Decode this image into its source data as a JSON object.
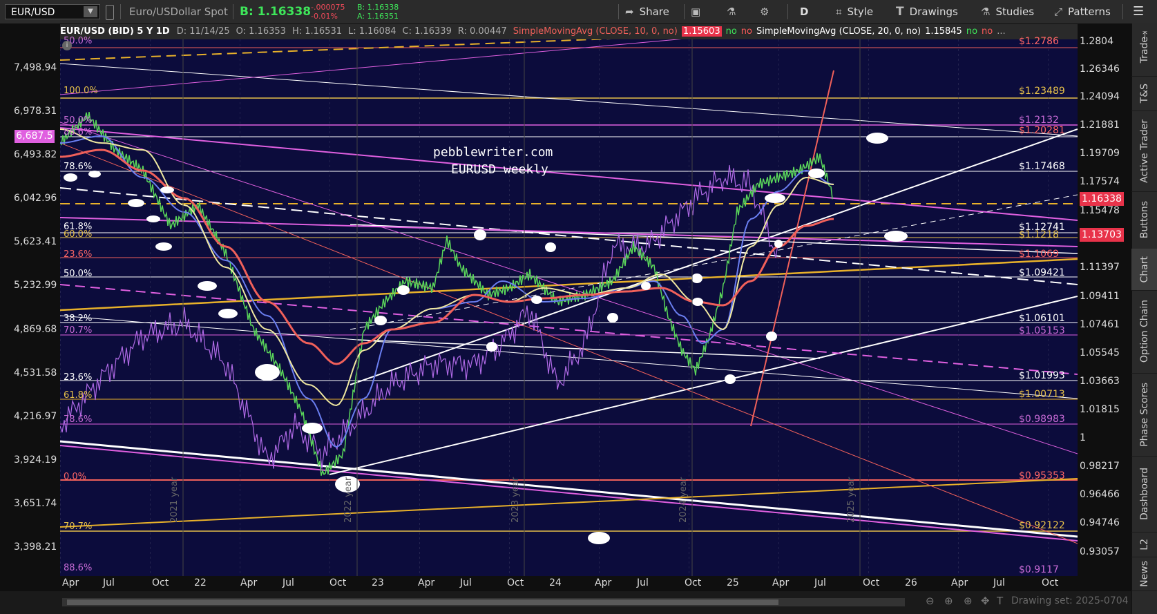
{
  "topbar": {
    "symbol": "EUR/USD",
    "description": "Euro/USDollar Spot",
    "bid_label": "B: 1.16338",
    "change_abs": "-.000075",
    "change_pct": "-0.01%",
    "bid_small": "B: 1.16338",
    "ask_small": "A: 1.16351",
    "share": "Share",
    "timeframe": "D",
    "style": "Style",
    "drawings": "Drawings",
    "studies": "Studies",
    "patterns": "Patterns"
  },
  "infobar": {
    "symbol_period": "EUR/USD (BID) 5 Y 1D",
    "date": "D: 11/14/25",
    "open": "O: 1.16353",
    "high": "H: 1.16531",
    "low": "L: 1.16084",
    "close": "C: 1.16339",
    "range": "R: 0.00447",
    "sma1_name": "SimpleMovingAvg (CLOSE, 10, 0, no)",
    "sma1_value": "1.15603",
    "sma2_name": "SimpleMovingAvg (CLOSE, 20, 0, no)",
    "sma2_value": "1.15845",
    "flag_no": "no",
    "more": "..."
  },
  "watermark": {
    "line1": "pebblewriter.com",
    "line2": "EURUSD weekly"
  },
  "left_axis_labels": [
    "7,498.94",
    "6,978.31",
    "6,493.82",
    "6,042.96",
    "5,623.41",
    "5,232.99",
    "4,869.68",
    "4,531.58",
    "4,216.97",
    "3,924.19",
    "3,651.74",
    "3,398.21"
  ],
  "left_axis_marker": "6,687.5",
  "right_axis_labels": [
    "1.2804",
    "1.26346",
    "1.24094",
    "1.21881",
    "1.19709",
    "1.17574",
    "1.15478",
    "1.13397",
    "1.11397",
    "1.09411",
    "1.07461",
    "1.05545",
    "1.03663",
    "1.01815",
    "1",
    "0.98217",
    "0.96466",
    "0.94746",
    "0.93057"
  ],
  "price_badges": [
    {
      "text": "1.16338",
      "color": "#e8334a"
    },
    {
      "text": "1.13703",
      "color": "#e8334a"
    }
  ],
  "x_axis_labels": [
    "Apr",
    "Jul",
    "Oct",
    "22",
    "Apr",
    "Jul",
    "Oct",
    "23",
    "Apr",
    "Jul",
    "Oct",
    "24",
    "Apr",
    "Jul",
    "Oct",
    "25",
    "Apr",
    "Jul",
    "Oct",
    "26",
    "Apr",
    "Jul",
    "Oct"
  ],
  "year_labels": [
    "2021 year",
    "2022 year",
    "2023 year",
    "2024 year",
    "2025 year"
  ],
  "fib_left": [
    {
      "text": "50.0%",
      "color": "#c86bd6"
    },
    {
      "text": "100.0%",
      "color": "#e8c24a"
    },
    {
      "text": "50.0%",
      "color": "#c86bd6"
    },
    {
      "text": "88.6%",
      "color": "#c86bd6"
    },
    {
      "text": "78.6%",
      "color": "#ffffff"
    },
    {
      "text": "61.8%",
      "color": "#ffffff"
    },
    {
      "text": "60.0%",
      "color": "#e8c24a"
    },
    {
      "text": "23.6%",
      "color": "#ff6666"
    },
    {
      "text": "50.0%",
      "color": "#ffffff"
    },
    {
      "text": "38.2%",
      "color": "#ffffff"
    },
    {
      "text": "70.7%",
      "color": "#c86bd6"
    },
    {
      "text": "23.6%",
      "color": "#ffffff"
    },
    {
      "text": "61.8%",
      "color": "#e8c24a"
    },
    {
      "text": "78.6%",
      "color": "#c86bd6"
    },
    {
      "text": "0.0%",
      "color": "#ff6666"
    },
    {
      "text": "70.7%",
      "color": "#e8c24a"
    },
    {
      "text": "88.6%",
      "color": "#c86bd6"
    }
  ],
  "level_labels": [
    {
      "text": "$1.2786",
      "color": "#ff6666"
    },
    {
      "text": "$1.23489",
      "color": "#e8c24a"
    },
    {
      "text": "$1.2132",
      "color": "#c86bd6"
    },
    {
      "text": "$1.20281",
      "color": "#ff6666"
    },
    {
      "text": "$1.17468",
      "color": "#ffffff"
    },
    {
      "text": "$1.12741",
      "color": "#ffffff"
    },
    {
      "text": "$1.1218",
      "color": "#e8c24a"
    },
    {
      "text": "$1.1069",
      "color": "#ff6666"
    },
    {
      "text": "$1.09421",
      "color": "#ffffff"
    },
    {
      "text": "$1.06101",
      "color": "#ffffff"
    },
    {
      "text": "$1.05153",
      "color": "#c86bd6"
    },
    {
      "text": "$1.01993",
      "color": "#ffffff"
    },
    {
      "text": "$1.00713",
      "color": "#e8c24a"
    },
    {
      "text": "$0.98983",
      "color": "#c86bd6"
    },
    {
      "text": "$0.95353",
      "color": "#ff6666"
    },
    {
      "text": "$0.92122",
      "color": "#e8c24a"
    },
    {
      "text": "$0.9117",
      "color": "#c86bd6"
    }
  ],
  "sidebar_tabs": [
    "Trade",
    "T&S",
    "Active Trader",
    "Buttons",
    "Chart",
    "Option Chain",
    "Phase Scores",
    "Dashboard",
    "L2",
    "News"
  ],
  "bottom": {
    "drawing_set": "Drawing set: 2025-0704"
  },
  "colors": {
    "plot_bg": "#0c0c3c",
    "price": "#b06ae6",
    "sma_red": "#f0605a",
    "sma_yellow": "#f0e8a0",
    "sma_blue": "#6a7ef0",
    "gold": "#e8b12a",
    "magenta": "#e060e0"
  }
}
